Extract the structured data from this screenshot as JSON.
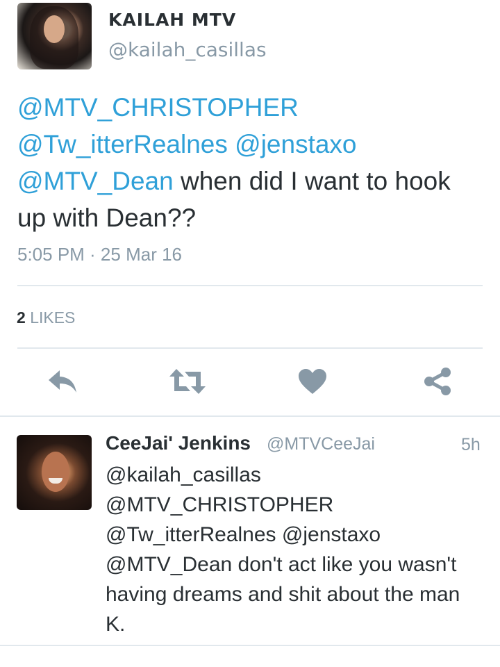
{
  "tweet": {
    "author": {
      "display_name": "KAILAH MTV",
      "handle": "@kailah_casillas",
      "avatar": "profile-photo"
    },
    "text_lines": [
      [
        {
          "text": "@MTV_CHRISTOPHER",
          "mention": true
        }
      ],
      [
        {
          "text": "@Tw_itterRealnes",
          "mention": true
        },
        {
          "text": " ",
          "mention": false
        },
        {
          "text": "@jenstaxo",
          "mention": true
        }
      ],
      [
        {
          "text": "@MTV_Dean",
          "mention": true
        },
        {
          "text": " when did I want to hook",
          "mention": false
        }
      ],
      [
        {
          "text": "up with Dean??",
          "mention": false
        }
      ]
    ],
    "timestamp": "5:05 PM · 25 Mar 16",
    "likes": {
      "count": "2",
      "label": "LIKES"
    },
    "actions": [
      {
        "name": "reply",
        "icon": "reply-icon"
      },
      {
        "name": "retweet",
        "icon": "retweet-icon"
      },
      {
        "name": "like",
        "icon": "heart-icon"
      },
      {
        "name": "share",
        "icon": "share-icon"
      }
    ]
  },
  "reply": {
    "display_name": "CeeJai' Jenkins",
    "handle": "@MTVCeeJai",
    "time": "5h",
    "avatar": "profile-photo",
    "text_lines": [
      "@kailah_casillas",
      "@MTV_CHRISTOPHER",
      "@Tw_itterRealnes @jenstaxo",
      "@MTV_Dean don't act like you wasn't",
      "having dreams and shit about the man",
      "K."
    ]
  },
  "colors": {
    "mention": "#2fa0d8",
    "secondary_text": "#8899a6",
    "primary_text": "#292f33",
    "icon": "#8899a6",
    "divider": "#e1e8ed"
  }
}
